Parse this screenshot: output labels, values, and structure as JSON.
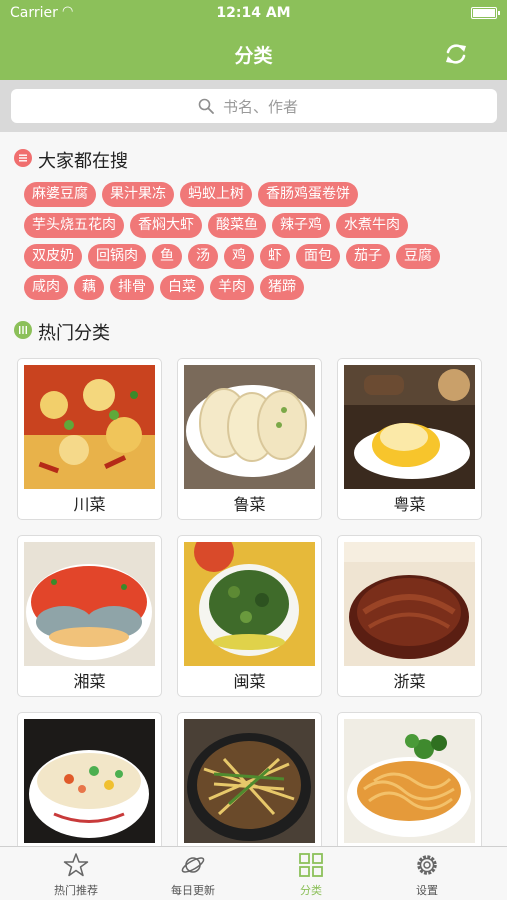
{
  "status_bar": {
    "carrier": "Carrier",
    "time": "12:14 AM"
  },
  "nav": {
    "title": "分类",
    "refresh_icon": "refresh-icon"
  },
  "search": {
    "placeholder": "书名、作者"
  },
  "hot_search": {
    "title": "大家都在搜",
    "rows": [
      [
        "麻婆豆腐",
        "果汁果冻",
        "蚂蚁上树",
        "香肠鸡蛋卷饼"
      ],
      [
        "芋头烧五花肉",
        "香焖大虾",
        "酸菜鱼",
        "辣子鸡",
        "水煮牛肉"
      ],
      [
        "双皮奶",
        "回锅肉",
        "鱼",
        "汤",
        "鸡",
        "虾",
        "面包",
        "茄子",
        "豆腐"
      ],
      [
        "咸肉",
        "藕",
        "排骨",
        "白菜",
        "羊肉",
        "猪蹄"
      ]
    ]
  },
  "hot_categories": {
    "title": "热门分类",
    "items": [
      "川菜",
      "鲁菜",
      "粤菜",
      "湘菜",
      "闽菜",
      "浙菜",
      "",
      "",
      ""
    ]
  },
  "tabbar": {
    "tabs": [
      {
        "label": "热门推荐",
        "icon": "star-icon",
        "active": false
      },
      {
        "label": "每日更新",
        "icon": "planet-icon",
        "active": false
      },
      {
        "label": "分类",
        "icon": "grid-icon",
        "active": true
      },
      {
        "label": "设置",
        "icon": "gear-icon",
        "active": false
      }
    ]
  },
  "colors": {
    "accent": "#8cc05a",
    "tag": "#f07878",
    "search_bg": "#d9d9d9"
  }
}
